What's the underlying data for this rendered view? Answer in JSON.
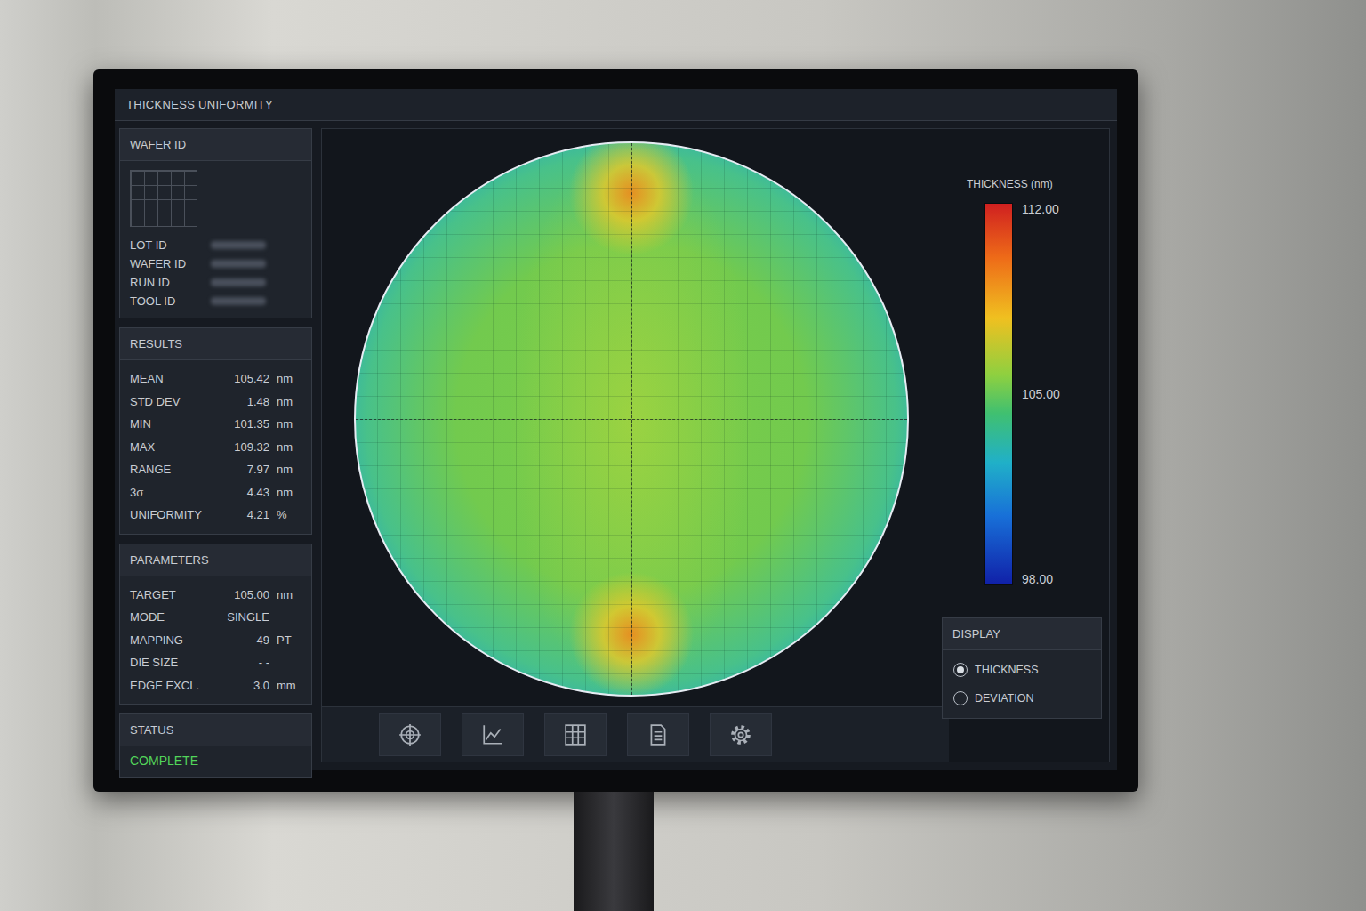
{
  "window": {
    "title": "THICKNESS UNIFORMITY"
  },
  "wafer_panel": {
    "title": "WAFER ID",
    "fields": [
      {
        "label": "LOT ID"
      },
      {
        "label": "WAFER ID"
      },
      {
        "label": "RUN ID"
      },
      {
        "label": "TOOL ID"
      }
    ]
  },
  "results": {
    "title": "RESULTS",
    "rows": [
      {
        "label": "MEAN",
        "value": "105.42",
        "unit": "nm"
      },
      {
        "label": "STD DEV",
        "value": "1.48",
        "unit": "nm"
      },
      {
        "label": "MIN",
        "value": "101.35",
        "unit": "nm"
      },
      {
        "label": "MAX",
        "value": "109.32",
        "unit": "nm"
      },
      {
        "label": "RANGE",
        "value": "7.97",
        "unit": "nm"
      },
      {
        "label": "3σ",
        "value": "4.43",
        "unit": "nm"
      },
      {
        "label": "UNIFORMITY",
        "value": "4.21",
        "unit": "%"
      }
    ]
  },
  "parameters": {
    "title": "PARAMETERS",
    "rows": [
      {
        "label": "TARGET",
        "value": "105.00",
        "unit": "nm"
      },
      {
        "label": "MODE",
        "value": "SINGLE",
        "unit": ""
      },
      {
        "label": "MAPPING",
        "value": "49",
        "unit": "PT"
      },
      {
        "label": "DIE SIZE",
        "value": "- -",
        "unit": ""
      },
      {
        "label": "EDGE EXCL.",
        "value": "3.0",
        "unit": "mm"
      }
    ]
  },
  "status_panel": {
    "title": "STATUS",
    "value": "COMPLETE"
  },
  "legend": {
    "title": "THICKNESS (nm)",
    "max": "112.00",
    "mid": "105.00",
    "min": "98.00"
  },
  "display": {
    "title": "DISPLAY",
    "options": [
      {
        "label": "THICKNESS",
        "selected": true
      },
      {
        "label": "DEVIATION",
        "selected": false
      }
    ]
  }
}
